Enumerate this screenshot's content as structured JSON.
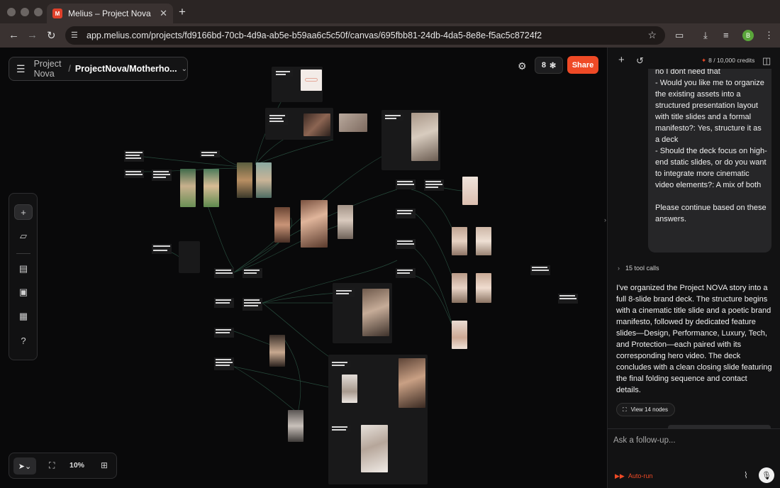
{
  "browser": {
    "tab_title": "Melius – Project Nova",
    "url": "app.melius.com/projects/fd9166bd-70cb-4d9a-ab5e-b59aa6c5c50f/canvas/695fbb81-24db-4da5-8e8e-f5ac5c8724f2",
    "profile_initial": "B",
    "icons": {
      "back": "arrow-left-icon",
      "forward": "arrow-right-icon",
      "reload": "reload-icon",
      "bookmark": "star-icon"
    }
  },
  "canvas": {
    "breadcrumb": {
      "project": "Project Nova",
      "separator": "/",
      "canvas": "ProjectNova/Motherho..."
    },
    "node_count": "8",
    "share_label": "Share",
    "zoom": "10%",
    "accent": "#ef4a26"
  },
  "panel": {
    "credits": "8 / 10,000 credits",
    "user_message": "no I dont need that\n- Would you like me to organize the existing assets into a structured presentation layout with title slides and a formal manifesto?: Yes, structure it as a deck\n- Should the deck focus on high-end static slides, or do you want to integrate more cinematic video elements?: A mix of both\n\nPlease continue based on these answers.",
    "tool_calls": "15 tool calls",
    "assistant_message": "I've organized the Project NOVA story into a full 8-slide brand deck. The structure begins with a cinematic title slide and a poetic brand manifesto, followed by dedicated feature slides—Design, Performance, Luxury, Tech, and Protection—each paired with its corresponding hero video. The deck concludes with a clean closing slide featuring the final folding sequence and contact details.",
    "view_nodes": "View 14 nodes",
    "followup_placeholder": "Ask a follow-up...",
    "autorun": "Auto-run"
  }
}
